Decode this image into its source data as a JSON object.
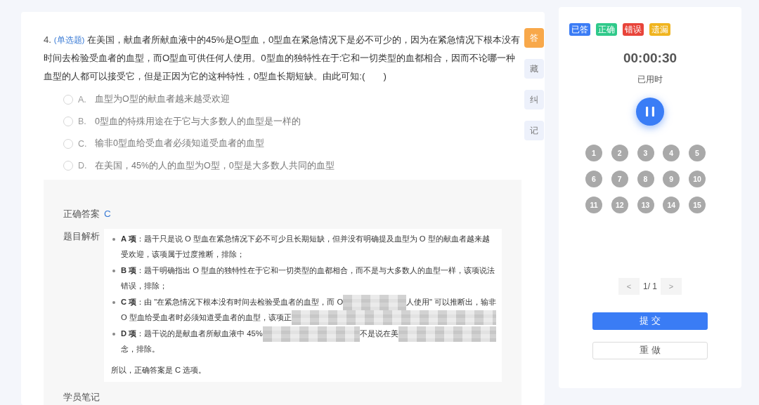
{
  "question": {
    "number": "4.",
    "type_tag": "(单选题)",
    "text": "在美国，献血者所献血液中的45%是O型血，0型血在紧急情况下是必不可少的，因为在紧急情况下根本没有时间去检验受血者的血型，而O型血可供任何人使用。0型血的独特性在于:它和一切类型的血都相合，因而不论哪一种血型的人都可以接受它，但是正因为它的这种特性，0型血长期短缺。由此可知:(　　)"
  },
  "options": [
    {
      "letter": "A.",
      "text": "血型为O型的献血者越来越受欢迎",
      "selected": false
    },
    {
      "letter": "B.",
      "text": "0型血的特殊用途在于它与大多数人的血型是一样的",
      "selected": false
    },
    {
      "letter": "C.",
      "text": "输非0型血给受血者必须知道受血者的血型",
      "selected": false
    },
    {
      "letter": "D.",
      "text": "在美国，45%的人的血型为O型，0型是大多数人共同的血型",
      "selected": false
    }
  ],
  "side_tabs": [
    {
      "label": "答",
      "selected": true
    },
    {
      "label": "藏",
      "selected": false
    },
    {
      "label": "纠",
      "selected": false
    },
    {
      "label": "记",
      "selected": false
    }
  ],
  "answer": {
    "label": "正确答案",
    "value": "C"
  },
  "analysis": {
    "label": "题目解析",
    "items": [
      {
        "kind": "text",
        "text": "**A 项**：题干只是说 O 型血在紧急情况下必不可少且长期短缺，但并没有明确提及血型为 O 型的献血者越来越受欢迎，该项属于过度推断，排除；"
      },
      {
        "kind": "text",
        "text": "**B 项**：题干明确指出 O 型血的独特性在于它和一切类型的血都相合，而不是与大多数人的血型一样，该项说法错误，排除；"
      },
      {
        "kind": "redacted",
        "lines": [
          [
            {
              "kind": "text",
              "text": "**C 项**：由 \"在紧急情况下根本没有时间去检验受血者的血型，而 O"
            },
            {
              "kind": "mosaic"
            },
            {
              "kind": "text",
              "text": "人使用\" 可以推断出，输非"
            }
          ],
          [
            {
              "kind": "text",
              "text": "O 型血给受血者时必须知道受血者的血型，该项正"
            },
            {
              "kind": "mosaic"
            }
          ]
        ]
      },
      {
        "kind": "redacted",
        "lines": [
          [
            {
              "kind": "text",
              "text": "**D 项**：题干说的是献血者所献血液中 45%"
            },
            {
              "kind": "mosaic"
            },
            {
              "kind": "text",
              "text": "不是说在美"
            },
            {
              "kind": "mosaic"
            }
          ],
          [
            {
              "kind": "text",
              "text": "念，排除。"
            }
          ]
        ]
      }
    ],
    "conclusion": "所以，正确答案是 C 选项。"
  },
  "notes": {
    "label": "学员笔记"
  },
  "legend": [
    {
      "label": "已答",
      "color": "#3b7cf5"
    },
    {
      "label": "正确",
      "color": "#2fc98a"
    },
    {
      "label": "错误",
      "color": "#e8443a"
    },
    {
      "label": "遗漏",
      "color": "#f0b41e"
    }
  ],
  "timer": {
    "time": "00:00:30",
    "caption": "已用时"
  },
  "question_numbers": [
    "1",
    "2",
    "3",
    "4",
    "5",
    "6",
    "7",
    "8",
    "9",
    "10",
    "11",
    "12",
    "13",
    "14",
    "15"
  ],
  "pager": {
    "prev": "<",
    "page": "1/ 1",
    "next": ">"
  },
  "buttons": [
    {
      "label": "提 交",
      "kind": "primary"
    },
    {
      "label": "重 做",
      "kind": "default"
    }
  ]
}
